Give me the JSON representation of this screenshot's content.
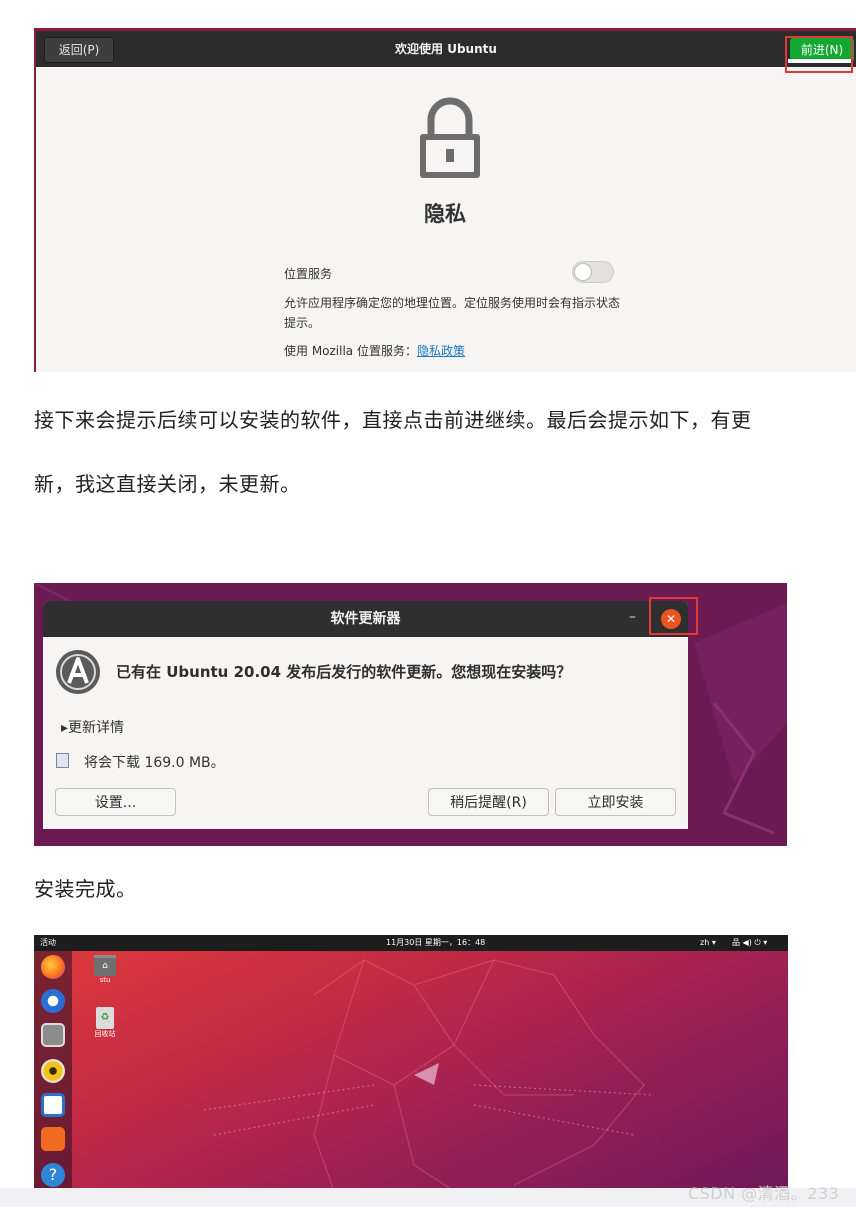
{
  "shot1": {
    "back_label": "返回(P)",
    "window_title": "欢迎使用 Ubuntu",
    "forward_label": "前进(N)",
    "page_title": "隐私",
    "location_label": "位置服务",
    "location_desc": "允许应用程序确定您的地理位置。定位服务使用时会有指示状态提示。",
    "mozilla_label": "使用 Mozilla 位置服务：",
    "privacy_link": "隐私政策",
    "location_enabled": false,
    "icon": "lock-icon"
  },
  "para1_line1": "接下来会提示后续可以安装的软件，直接点击前进继续。最后会提示如下，有更",
  "para1_line2": "新，我这直接关闭，未更新。",
  "shot2": {
    "dialog_title": "软件更新器",
    "minimize": "–",
    "close": "✕",
    "question": "已有在 Ubuntu 20.04 发布后发行的软件更新。您想现在安装吗？",
    "details": "更新详情",
    "download_text": "将会下载 169.0 MB。",
    "settings_btn": "设置...",
    "remind_btn": "稍后提醒(R)",
    "install_btn": "立即安装"
  },
  "para2": "安装完成。",
  "shot3": {
    "activities": "活动",
    "clock": "11月30日 星期一，16：48",
    "lang": "zh ▾",
    "tray": "品 ◀) ⏻ ▾",
    "home_label": "stu",
    "trash_label": "回收站"
  },
  "watermark": "CSDN @清酒。233",
  "colors": {
    "accent_green": "#13a831",
    "ubuntu_orange": "#e95420",
    "highlight_red": "#e03a3a",
    "link_blue": "#1a78c2"
  }
}
